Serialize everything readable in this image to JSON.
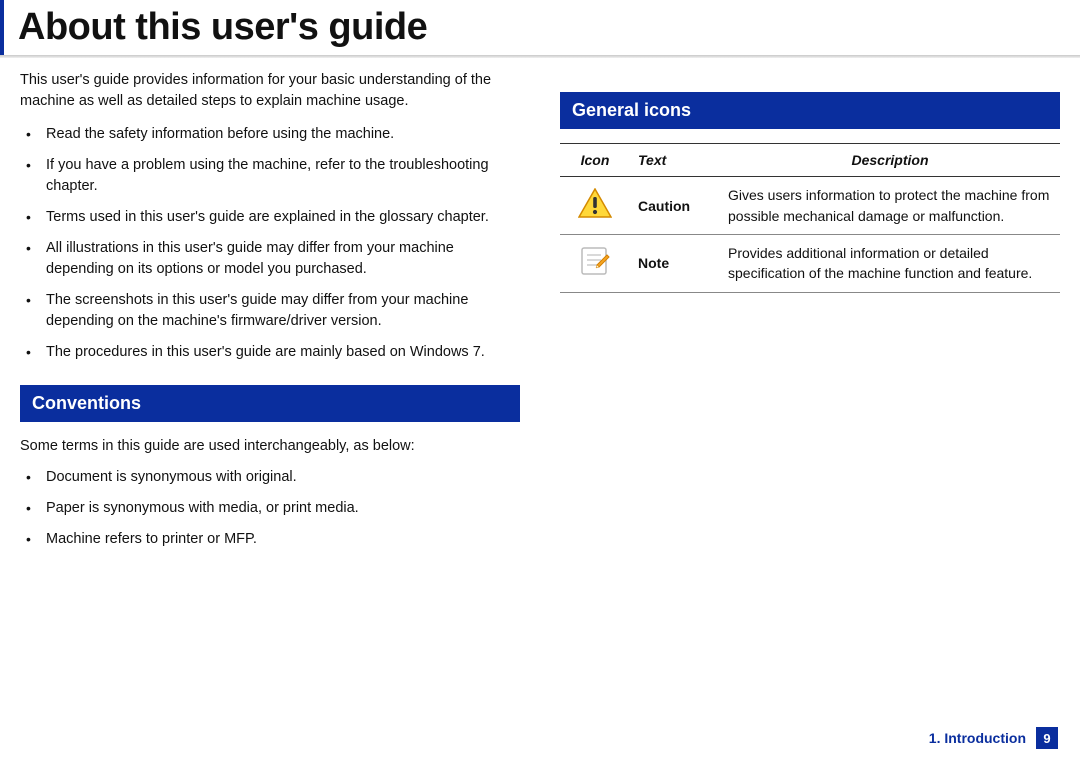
{
  "title": "About this user's guide",
  "left": {
    "intro": "This user's guide provides information for your basic understanding of the machine as well as detailed steps to explain machine usage.",
    "bullets": [
      "Read the safety information before using the machine.",
      "If you have a problem using the machine, refer to the troubleshooting chapter.",
      "Terms used in this user's guide are explained in the glossary chapter.",
      "All illustrations in this user's guide may differ from your machine depending on its options or model you purchased.",
      "The screenshots in this user's guide may differ from your machine depending on the machine's firmware/driver version.",
      "The procedures in this user's guide are mainly based on Windows 7."
    ],
    "conventions_header": "Conventions",
    "conventions_intro": "Some terms in this guide are used interchangeably, as below:",
    "conventions_bullets": [
      "Document is synonymous with original.",
      "Paper is synonymous with media, or print media.",
      "Machine refers to printer or MFP."
    ]
  },
  "right": {
    "header": "General icons",
    "table": {
      "headers": [
        "Icon",
        "Text",
        "Description"
      ],
      "rows": [
        {
          "icon": "caution-icon",
          "text": "Caution",
          "desc": "Gives users information to protect the machine from possible mechanical damage or malfunction."
        },
        {
          "icon": "note-icon",
          "text": "Note",
          "desc": "Provides additional information or detailed specification of the machine function and feature."
        }
      ]
    }
  },
  "footer": {
    "chapter": "1. Introduction",
    "page": "9"
  }
}
